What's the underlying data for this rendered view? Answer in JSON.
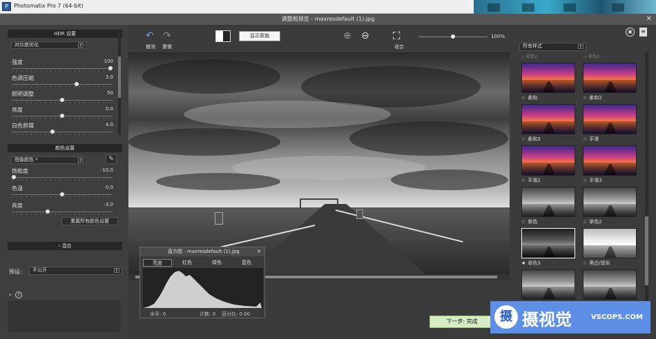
{
  "app": {
    "title": "Photomatix Pro 7 (64-bit)",
    "icon": "photomatix-app-icon"
  },
  "dialog": {
    "title": "调整和预览 - maxresdefault (1).jpg",
    "close": "✕"
  },
  "left": {
    "hdr_title": "HDR 设置",
    "method": "对比度优化",
    "sliders": [
      {
        "label": "强度",
        "value": "100",
        "pos": 1.0
      },
      {
        "label": "色调压缩",
        "value": "3.0",
        "pos": 0.65
      },
      {
        "label": "照明调整",
        "value": "50",
        "pos": 0.5
      },
      {
        "label": "亮度",
        "value": "0.0",
        "pos": 0.5
      },
      {
        "label": "白色剪辑",
        "value": "4.0",
        "pos": 0.4
      }
    ],
    "color_title": "颜色设置",
    "color_mode": "图像颜色 *",
    "color_sliders": [
      {
        "label": "饱和度",
        "value": "-10.0",
        "pos": 0.0
      },
      {
        "label": "色温",
        "value": "0.0",
        "pos": 0.5
      },
      {
        "label": "亮度",
        "value": "-3.0",
        "pos": 0.35
      }
    ],
    "reset_color": "重置所有颜色设置",
    "blend_label": "混合",
    "preset_label": "预设:",
    "preset_value": "不公开"
  },
  "toolbar": {
    "undo": "撤消",
    "redo": "重做",
    "show_original": "显示原始",
    "fit": "适合",
    "zoom_level": "100%",
    "zoom_pos": 0.5
  },
  "histogram": {
    "title": "直方图 - maxresdefault (1).jpg",
    "close": "✕",
    "tabs": [
      "亮度",
      "红色",
      "绿色",
      "蓝色"
    ],
    "level_label": "水平: 0",
    "count_label": "计数: 0",
    "percent_label": "百分比: 0.00"
  },
  "right": {
    "style_filter": "所有样式",
    "partial_top": [
      "☆ 彩色2",
      "☆ 彩色3"
    ],
    "thumbs": [
      {
        "label": "柔和",
        "kind": "color"
      },
      {
        "label": "柔和2",
        "kind": "color"
      },
      {
        "label": "柔和3",
        "kind": "color"
      },
      {
        "label": "平滑",
        "kind": "color"
      },
      {
        "label": "平滑2",
        "kind": "color"
      },
      {
        "label": "平滑3",
        "kind": "color"
      },
      {
        "label": "单色",
        "kind": "mono"
      },
      {
        "label": "单色2",
        "kind": "mono"
      },
      {
        "label": "单色3",
        "kind": "mono-dark",
        "selected": true
      },
      {
        "label": "黑白/现实",
        "kind": "mono-light"
      },
      {
        "label": "",
        "kind": "mono"
      },
      {
        "label": "",
        "kind": "mono"
      }
    ]
  },
  "next_button": "下一步: 完成",
  "watermark": {
    "logo": "摄",
    "text": "摄视觉",
    "site": "VSCOPS.COM"
  }
}
